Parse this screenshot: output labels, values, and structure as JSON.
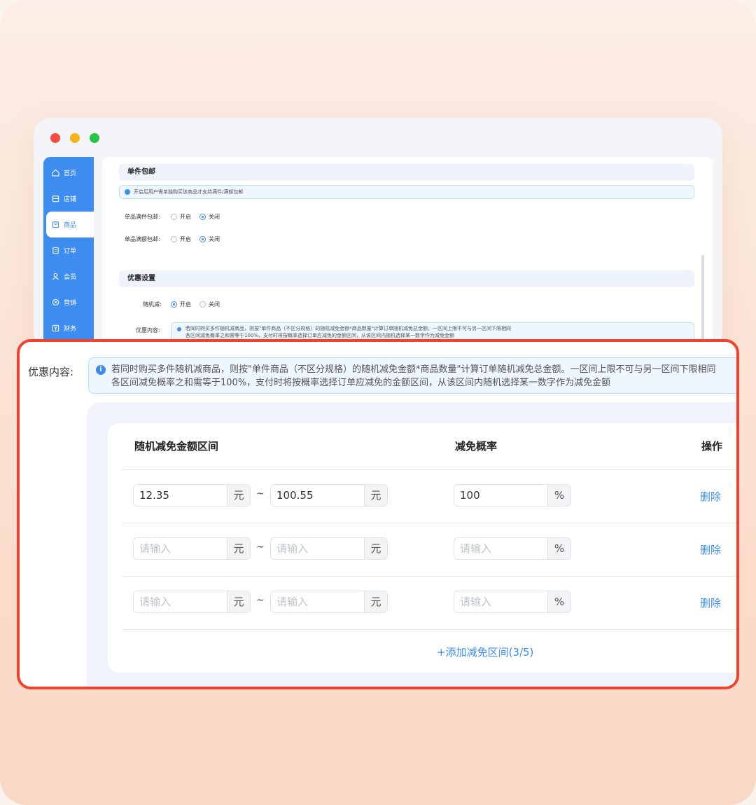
{
  "sidebar": {
    "items": [
      {
        "label": "首页",
        "icon": "home-icon"
      },
      {
        "label": "店铺",
        "icon": "store-icon"
      },
      {
        "label": "商品",
        "icon": "bag-icon"
      },
      {
        "label": "订单",
        "icon": "order-icon"
      },
      {
        "label": "会员",
        "icon": "user-icon"
      },
      {
        "label": "营销",
        "icon": "marketing-icon"
      },
      {
        "label": "财务",
        "icon": "finance-icon"
      }
    ]
  },
  "back": {
    "section1_title": "单件包邮",
    "section1_info": "开启后用户需单独购买该商品才支持满件/满额包邮",
    "row1_label": "单品满件包邮:",
    "row2_label": "单品满额包邮:",
    "opt_on": "开启",
    "opt_off": "关闭",
    "section2_title": "优惠设置",
    "random_label": "随机减:",
    "content_label": "优惠内容:",
    "mini_info_1": "若同时购买多件随机减商品，则按\"单件商品（不区分规格）的随机减免金额*商品数量\"计算订单随机减免总金额。一区间上限不可与另一区间下限相同",
    "mini_info_2": "各区间减免概率之和需等于100%，支付时将按概率选择订单应减免的金额区间，从该区间内随机选择某一数字作为减免金额"
  },
  "zoom": {
    "label": "优惠内容:",
    "info_line1": "若同时购买多件随机减商品，则按\"单件商品（不区分规格）的随机减免金额*商品数量\"计算订单随机减免总金额。一区间上限不可与另一区间下限相同",
    "info_line2": "各区间减免概率之和需等于100%，支付时将按概率选择订单应减免的金额区间，从该区间内随机选择某一数字作为减免金额",
    "col_range": "随机减免金额区间",
    "col_rate": "减免概率",
    "col_ops": "操作",
    "unit_yuan": "元",
    "unit_pct": "%",
    "tilde": "~",
    "placeholder": "请输入",
    "delete": "删除",
    "rows": [
      {
        "min": "12.35",
        "max": "100.55",
        "rate": "100"
      },
      {
        "min": "",
        "max": "",
        "rate": ""
      },
      {
        "min": "",
        "max": "",
        "rate": ""
      }
    ],
    "add_button": "+添加减免区间(3/5)"
  },
  "colors": {
    "accent": "#3d8cf0",
    "highlight": "#f2412d"
  }
}
